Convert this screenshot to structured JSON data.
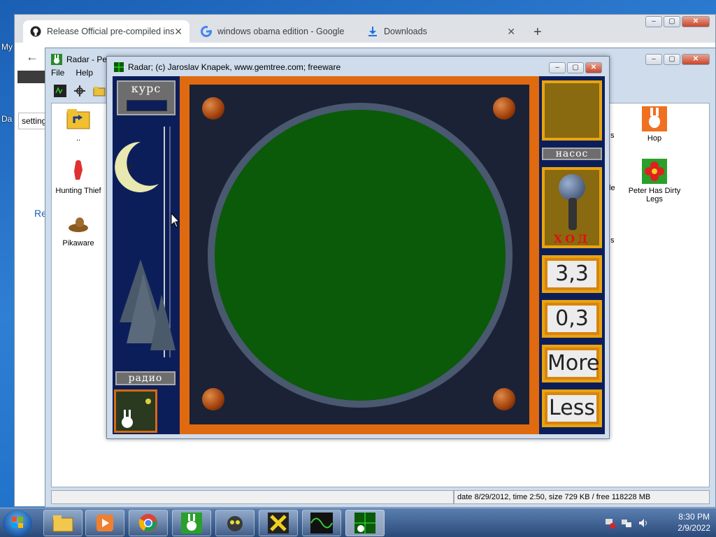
{
  "desktop": {
    "labels": [
      "My",
      "Da"
    ]
  },
  "chrome": {
    "tabs": [
      {
        "label": "Release Official pre-compiled ins",
        "icon": "github-icon"
      },
      {
        "label": "windows obama edition - Google",
        "icon": "google-icon"
      },
      {
        "label": "Downloads",
        "icon": "download-icon"
      }
    ],
    "page": {
      "search_value": "setting",
      "link_partial": "Re"
    }
  },
  "pack": {
    "title": "Radar - Pet",
    "menu": [
      "File",
      "Help"
    ],
    "items": [
      {
        "label": "..",
        "icon": "folder-up-icon"
      },
      {
        "label": "Hunting Thief",
        "icon": "thief-icon"
      },
      {
        "label": "Pikaware",
        "icon": "pikaware-icon"
      },
      {
        "label": "Hop",
        "icon": "hop-bunny-icon"
      },
      {
        "label": "Peter Has Dirty Legs",
        "icon": "flower-icon"
      }
    ],
    "partial_labels": [
      "s",
      "le",
      "s"
    ],
    "status_text": "date 8/29/2012, time 2:50, size 729 KB / free 118228 MB"
  },
  "radar": {
    "title": "Radar;   (c) Jaroslav Knapek, www.gemtree.com;   freeware",
    "kurs_label": "курс",
    "radio_label": "радио",
    "nasos_label": "насос",
    "hod_label": "ХОД",
    "value1": "3,3",
    "value2": "0,3",
    "more_label": "More",
    "less_label": "Less"
  },
  "taskbar": {
    "time": "8:30 PM",
    "date": "2/9/2022"
  },
  "colors": {
    "radar_frame": "#e06a10",
    "radar_scope": "#0a5a0a",
    "gold": "#e8a410"
  }
}
